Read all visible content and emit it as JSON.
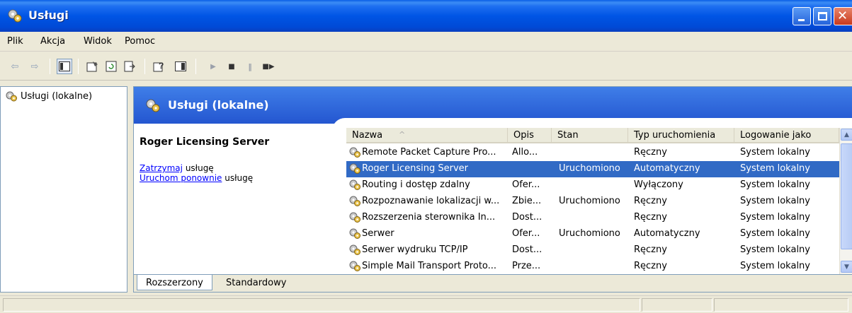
{
  "window": {
    "title": "Usługi"
  },
  "menu": [
    "Plik",
    "Akcja",
    "Widok",
    "Pomoc"
  ],
  "toolbar": {
    "buttons": [
      "back-arrow",
      "forward-arrow",
      "show-tree",
      "properties",
      "refresh",
      "export-list",
      "help",
      "console-tree-view",
      "start",
      "stop",
      "pause",
      "restart"
    ]
  },
  "tree": {
    "root_label": "Usługi (lokalne)"
  },
  "banner": {
    "title": "Usługi (lokalne)"
  },
  "details": {
    "service_name": "Roger Licensing Server",
    "action_stop_link": "Zatrzymaj",
    "action_stop_text": " usługę",
    "action_restart_link": "Uruchom ponownie",
    "action_restart_text": " usługę"
  },
  "list": {
    "columns": [
      "Nazwa",
      "Opis",
      "Stan",
      "Typ uruchomienia",
      "Logowanie jako"
    ],
    "sort_indicator": "^",
    "rows": [
      {
        "name": "Remote Packet Capture Pro...",
        "desc": "Allo...",
        "state": "",
        "startup": "Ręczny",
        "logon": "System lokalny",
        "selected": false
      },
      {
        "name": "Roger Licensing Server",
        "desc": "",
        "state": "Uruchomiono",
        "startup": "Automatyczny",
        "logon": "System lokalny",
        "selected": true
      },
      {
        "name": "Routing i dostęp zdalny",
        "desc": "Ofer...",
        "state": "",
        "startup": "Wyłączony",
        "logon": "System lokalny",
        "selected": false
      },
      {
        "name": "Rozpoznawanie lokalizacji w...",
        "desc": "Zbie...",
        "state": "Uruchomiono",
        "startup": "Ręczny",
        "logon": "System lokalny",
        "selected": false
      },
      {
        "name": "Rozszerzenia sterownika In...",
        "desc": "Dost...",
        "state": "",
        "startup": "Ręczny",
        "logon": "System lokalny",
        "selected": false
      },
      {
        "name": "Serwer",
        "desc": "Ofer...",
        "state": "Uruchomiono",
        "startup": "Automatyczny",
        "logon": "System lokalny",
        "selected": false
      },
      {
        "name": "Serwer wydruku TCP/IP",
        "desc": "Dost...",
        "state": "",
        "startup": "Ręczny",
        "logon": "System lokalny",
        "selected": false
      },
      {
        "name": "Simple Mail Transport Proto...",
        "desc": "Prze...",
        "state": "",
        "startup": "Ręczny",
        "logon": "System lokalny",
        "selected": false
      }
    ]
  },
  "tabs": [
    "Rozszerzony",
    "Standardowy"
  ],
  "colors": {
    "selection": "#316AC5",
    "titlebar": "#0055E5",
    "link": "#0000FF"
  }
}
